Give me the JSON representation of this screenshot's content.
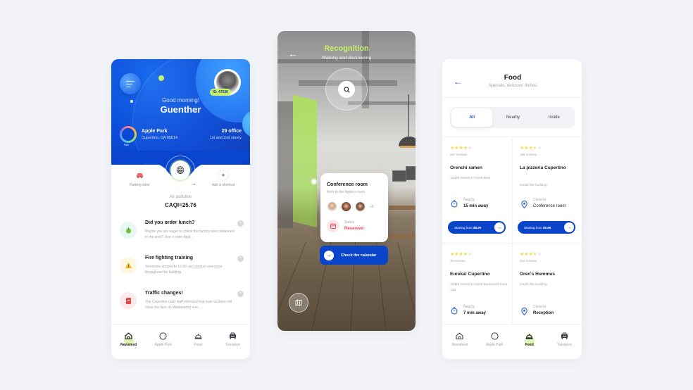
{
  "newsfeed_screen": {
    "greeting": "Good morning!",
    "user_name": "Guenther",
    "user_id_badge": "ID: 47936",
    "location": {
      "logo_label": "Park",
      "name": "Apple Park",
      "address": "Cupertino, CA 95014"
    },
    "office": {
      "title": "29 office",
      "subtitle": "1st and 2nd storey"
    },
    "shortcuts": {
      "parking_label": "Parking slots",
      "add_label": "Add a shortcut",
      "add_glyph": "+",
      "mood_emoji": "😁",
      "arrow_glyph": "→"
    },
    "air_pollution": {
      "label": "Air pollution",
      "value": "CAQI=25.76"
    },
    "notifications": [
      {
        "icon": "apple-icon",
        "glyph": "🍏",
        "title": "Did you order lunch?",
        "body": "Maybe you are eager to check the factory-new restaurant in the area? Use a code Appl...",
        "color": "#e6f8f1"
      },
      {
        "icon": "warning-icon",
        "glyph": "⚠",
        "title": "Fire fighting training",
        "body": "Tomorrow around At 10:20, we conduct exercises throughout the building",
        "color": "#fff7df"
      },
      {
        "icon": "traffic-sign-icon",
        "glyph": "▮",
        "title": "Traffic changes!",
        "body": "The Cupertino road staff informed that road workers will close the lane on Wednesday eve...",
        "color": "#fde8ea"
      }
    ],
    "dismiss_glyph": "×",
    "tabbar": [
      {
        "label": "Newsfeed",
        "active": true
      },
      {
        "label": "Apple Park",
        "active": false
      },
      {
        "label": "Food",
        "active": false
      },
      {
        "label": "Transport",
        "active": false
      }
    ]
  },
  "recognition_screen": {
    "back_glyph": "←",
    "title": "Recognition",
    "subtitle": "Walking and discovering",
    "room_card": {
      "title": "Conference room",
      "subtitle": "Next to the Apple's room",
      "more_people": "+5",
      "status_label": "Status",
      "status_value": "Reserved"
    },
    "calendar_button": "Check the calendar",
    "arrow_glyph": "→"
  },
  "food_screen": {
    "back_glyph": "←",
    "title": "Food",
    "subtitle": "Specials, delicious dishes",
    "filters": [
      {
        "label": "All",
        "active": true
      },
      {
        "label": "Nearby",
        "active": false
      },
      {
        "label": "Inside",
        "active": false
      }
    ],
    "restaurants": [
      {
        "rating": 4,
        "reviews": "697 reviews",
        "name": "Orenchi ramen",
        "address": "19359 Stevens Creek Blvd",
        "info_label": "Nearby",
        "info_value": "15 min away",
        "info_icon": "stopwatch-icon",
        "price_prefix": "Starting from",
        "price": "$8.99"
      },
      {
        "rating": 3.5,
        "reviews": "158 reviews",
        "name": "La pizzeria Cupertino",
        "address": "Inside the building",
        "info_label": "Close to",
        "info_value": "Conference room",
        "info_icon": "location-pin-icon",
        "price_prefix": "Starting from",
        "price": "$5.99"
      },
      {
        "rating": 4,
        "reviews": "48 reviews",
        "name": "Eureka! Cupertino",
        "address": "19369 Stevens Creek Boulevard Suite 130",
        "info_label": "Nearby",
        "info_value": "7 min away",
        "info_icon": "stopwatch-icon"
      },
      {
        "rating": 3.5,
        "reviews": "316 reviews",
        "name": "Oren's Hummus",
        "address": "Inside the building",
        "info_label": "Close to",
        "info_value": "Reception",
        "info_icon": "location-pin-icon"
      }
    ],
    "arrow_glyph": "→",
    "tabbar": [
      {
        "label": "Newsfeed",
        "active": false
      },
      {
        "label": "Apple Park",
        "active": false
      },
      {
        "label": "Food",
        "active": true
      },
      {
        "label": "Transport",
        "active": false
      }
    ]
  },
  "colors": {
    "brand_blue": "#0a44c9",
    "accent_lime": "#c8f26a",
    "reserved_red": "#e7455a",
    "star_yellow": "#f5d94a",
    "background": "#f3f4f8"
  }
}
